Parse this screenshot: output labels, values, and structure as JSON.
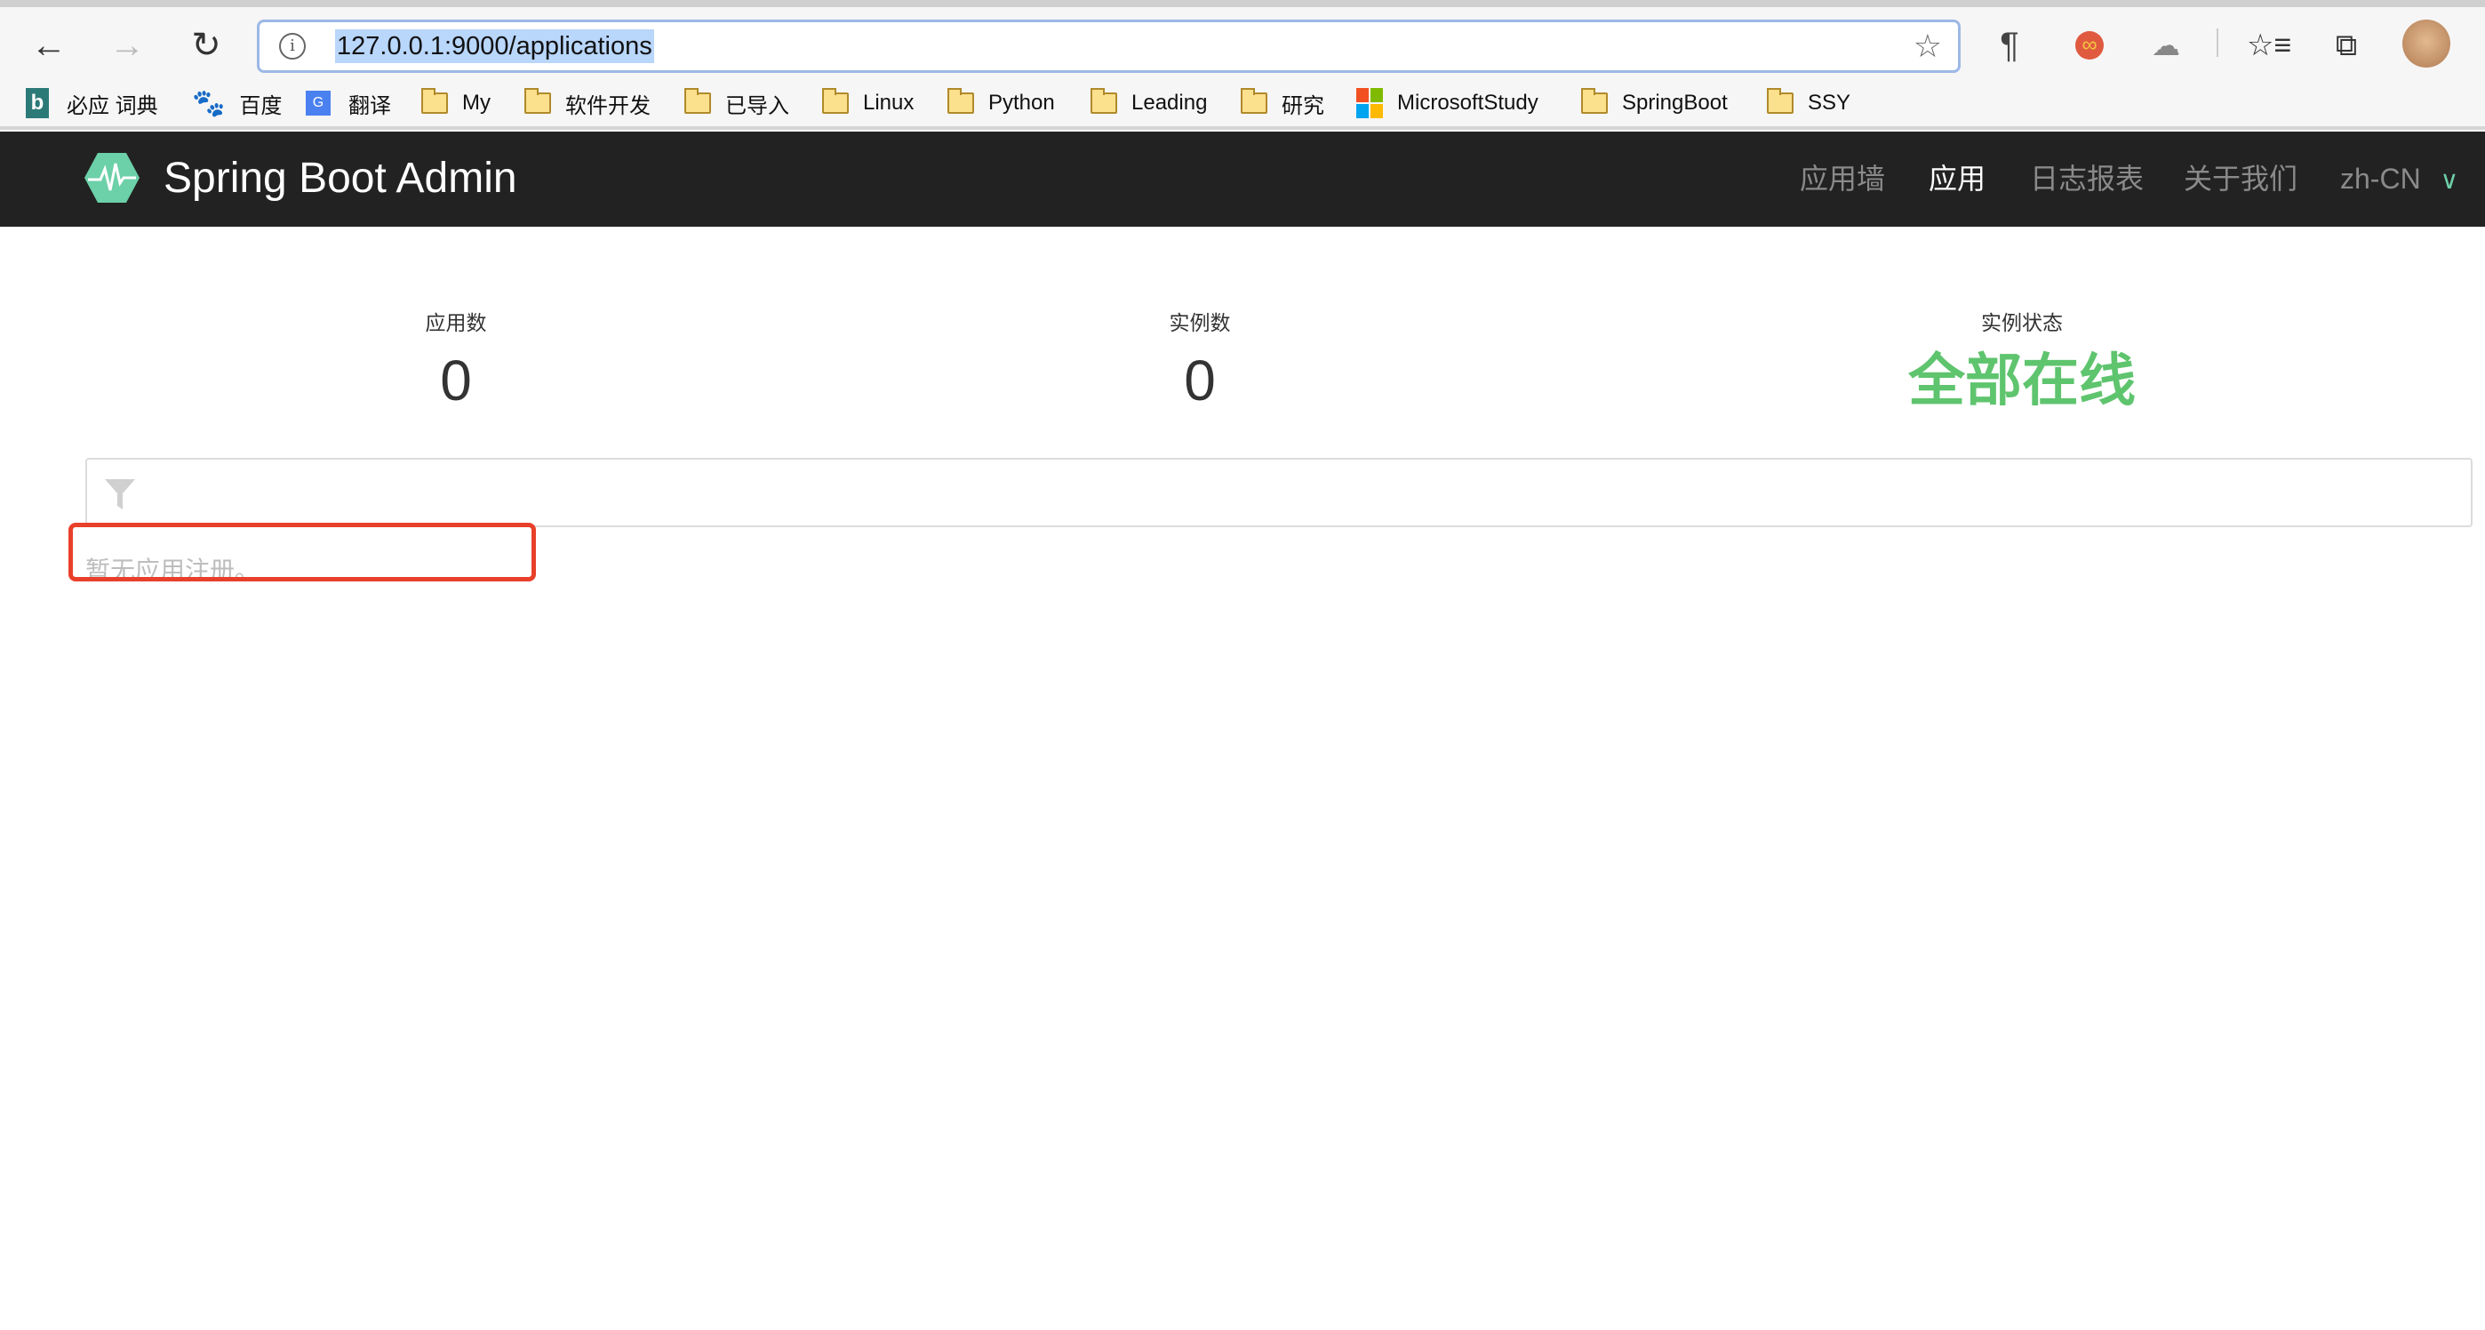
{
  "browser": {
    "url": "127.0.0.1:9000/applications",
    "bookmarks": [
      {
        "label": "必应 词典",
        "icon": "bing-icon"
      },
      {
        "label": "百度",
        "icon": "baidu-icon"
      },
      {
        "label": "翻译",
        "icon": "google-translate-icon"
      },
      {
        "label": "My",
        "icon": "folder-icon"
      },
      {
        "label": "软件开发",
        "icon": "folder-icon"
      },
      {
        "label": "已导入",
        "icon": "folder-icon"
      },
      {
        "label": "Linux",
        "icon": "folder-icon"
      },
      {
        "label": "Python",
        "icon": "folder-icon"
      },
      {
        "label": "Leading",
        "icon": "folder-icon"
      },
      {
        "label": "研究",
        "icon": "folder-icon"
      },
      {
        "label": "MicrosoftStudy",
        "icon": "microsoft-icon"
      },
      {
        "label": "SpringBoot",
        "icon": "folder-icon"
      },
      {
        "label": "SSY",
        "icon": "folder-icon"
      }
    ]
  },
  "header": {
    "brand": "Spring Boot Admin",
    "nav": [
      "应用墙",
      "应用",
      "日志报表",
      "关于我们"
    ],
    "active_nav": "应用",
    "language": "zh-CN",
    "accent": "#6cd0a8"
  },
  "stats": [
    {
      "label": "应用数",
      "value": "0"
    },
    {
      "label": "实例数",
      "value": "0"
    },
    {
      "label": "实例状态",
      "value": "全部在线",
      "color": "#5fc46e"
    }
  ],
  "filter": {
    "placeholder": ""
  },
  "empty_message": "暂无应用注册。"
}
